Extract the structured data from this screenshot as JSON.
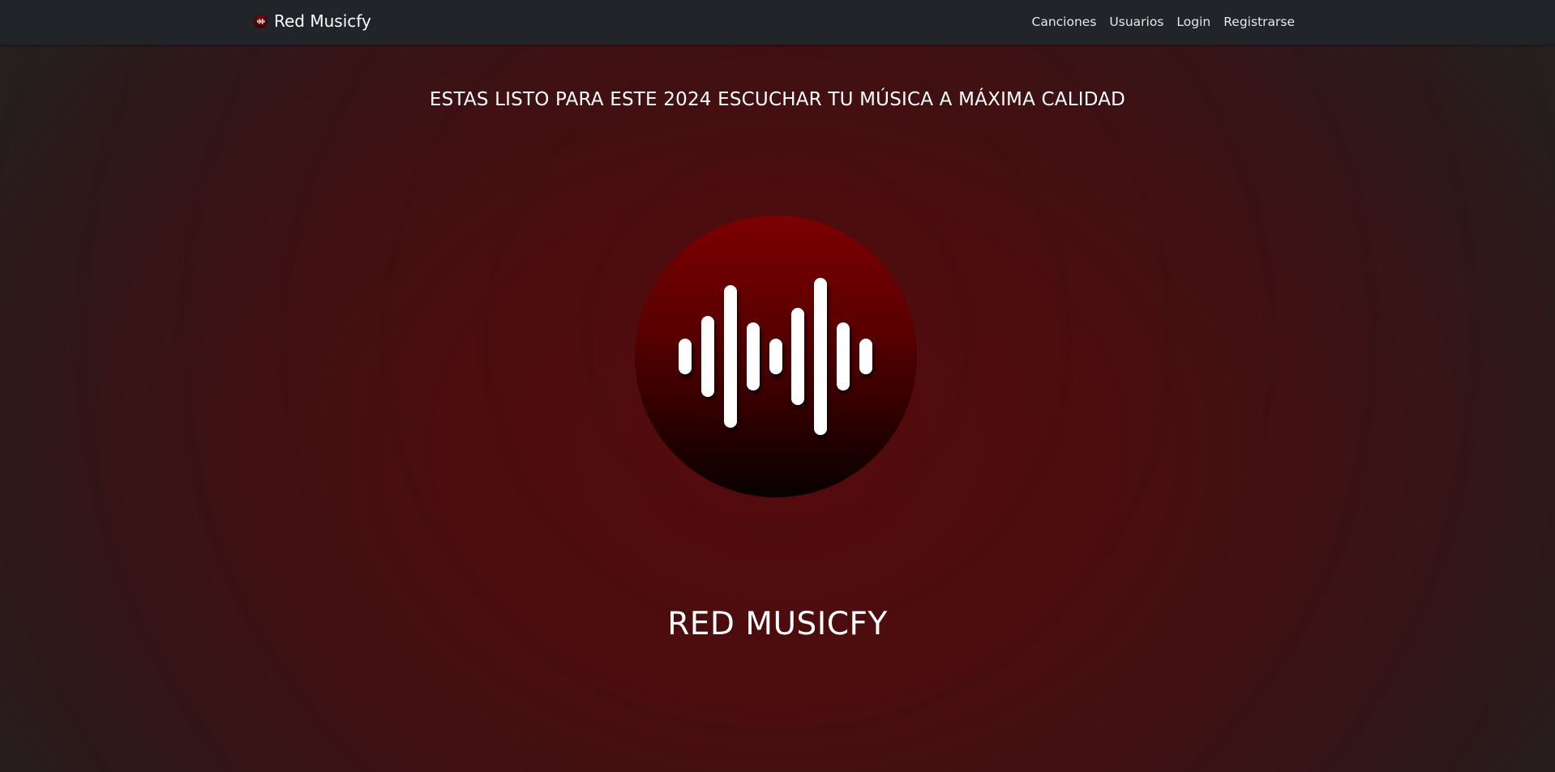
{
  "navbar": {
    "brand_name": "Red Musicfy",
    "brand_icon": "sound-wave-logo-icon",
    "links": [
      {
        "label": "Canciones"
      },
      {
        "label": "Usuarios"
      },
      {
        "label": "Login"
      },
      {
        "label": "Registrarse"
      }
    ]
  },
  "hero": {
    "headline": "ESTAS LISTO PARA ESTE 2024 ESCUCHAR TU MÚSICA A MÁXIMA CALIDAD",
    "logo_icon": "sound-wave-logo-icon",
    "title": "RED MUSICFY"
  },
  "colors": {
    "navbar_bg": "#212529",
    "accent_red": "#7c0001",
    "page_bg_center": "#560a0c",
    "text": "#ffffff"
  }
}
